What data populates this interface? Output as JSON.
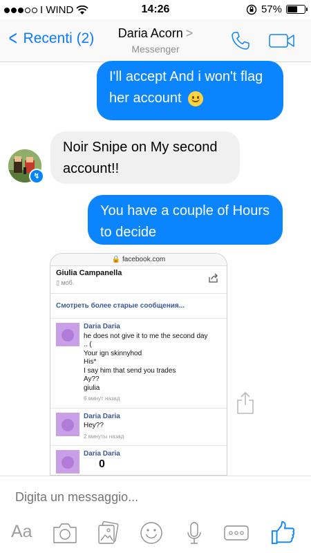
{
  "status_bar": {
    "carrier": "I WIND",
    "time": "14:26",
    "battery": "57%",
    "battery_level": 0.57
  },
  "nav": {
    "back_label": "Recenti (2)",
    "contact_name": "Daria Acorn",
    "subtitle": "Messenger"
  },
  "messages": [
    {
      "text": "I'll accept And i won't flag her account",
      "direction": "out"
    },
    {
      "text": "Noir Snipe on My second account!!",
      "direction": "in"
    },
    {
      "text": "You have a couple of Hours to decide",
      "direction": "out"
    }
  ],
  "screenshot": {
    "url": "facebook.com",
    "name": "Giulia Campanella",
    "sub": "моб.",
    "older_link": "Смотреть более старые сообщения...",
    "items": [
      {
        "author": "Daria Daria",
        "lines": [
          "he does not give it to me the second day",
          ".. (",
          "Your ign skinnyhod",
          "His*",
          "I say him that send you trades",
          "Ay??",
          "giulia"
        ],
        "time": "6 минут назад"
      },
      {
        "author": "Daria Daria",
        "lines": [
          "Hey??"
        ],
        "time": "2 минуты назад"
      },
      {
        "author": "Daria Daria",
        "lines": [
          "0"
        ],
        "time": ""
      }
    ]
  },
  "composer": {
    "placeholder": "Digita un messaggio...",
    "aa_label": "Aa"
  },
  "colors": {
    "accent": "#0a84ff",
    "incoming_bubble": "#f1f0f0",
    "fb_link": "#3b5998"
  }
}
